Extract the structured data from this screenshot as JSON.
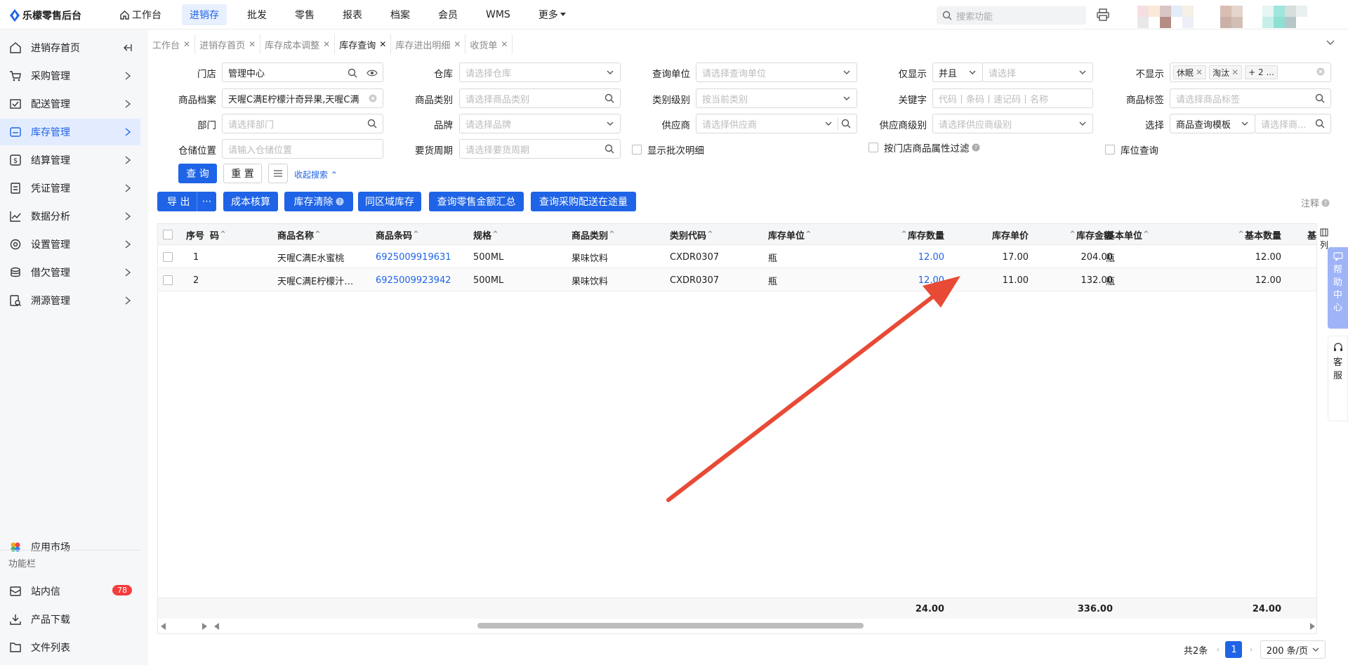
{
  "app": {
    "title": "乐檬零售后台"
  },
  "topnav": [
    {
      "label": "工作台",
      "icon": "home-icon"
    },
    {
      "label": "进销存",
      "active": true
    },
    {
      "label": "批发"
    },
    {
      "label": "零售"
    },
    {
      "label": "报表"
    },
    {
      "label": "档案"
    },
    {
      "label": "会员"
    },
    {
      "label": "WMS"
    },
    {
      "label": "更多"
    }
  ],
  "search": {
    "placeholder": "搜索功能"
  },
  "sidebar": {
    "items": [
      {
        "label": "进销存首页",
        "icon": "home-icon"
      },
      {
        "label": "采购管理",
        "icon": "cart-icon"
      },
      {
        "label": "配送管理",
        "icon": "delivery-icon"
      },
      {
        "label": "库存管理",
        "icon": "inventory-icon",
        "active": true
      },
      {
        "label": "结算管理",
        "icon": "settlement-icon"
      },
      {
        "label": "凭证管理",
        "icon": "voucher-icon"
      },
      {
        "label": "数据分析",
        "icon": "chart-icon"
      },
      {
        "label": "设置管理",
        "icon": "settings-icon"
      },
      {
        "label": "借欠管理",
        "icon": "debt-icon"
      },
      {
        "label": "溯源管理",
        "icon": "trace-icon"
      }
    ],
    "app_market": "应用市场",
    "section_label": "功能栏",
    "bottom": [
      {
        "label": "站内信",
        "badge": "78"
      },
      {
        "label": "产品下载"
      },
      {
        "label": "文件列表"
      }
    ]
  },
  "tabs": [
    {
      "label": "工作台"
    },
    {
      "label": "进销存首页"
    },
    {
      "label": "库存成本调整"
    },
    {
      "label": "库存查询",
      "active": true
    },
    {
      "label": "库存进出明细"
    },
    {
      "label": "收货单"
    }
  ],
  "filters": {
    "store": {
      "label": "门店",
      "value": "管理中心"
    },
    "warehouse": {
      "label": "仓库",
      "placeholder": "请选择仓库"
    },
    "query_unit": {
      "label": "查询单位",
      "placeholder": "请选择查询单位"
    },
    "only_show": {
      "label": "仅显示",
      "op": "并且",
      "placeholder": "请选择"
    },
    "hide": {
      "label": "不显示",
      "tags": [
        "休眠",
        "淘汰",
        "+ 2 ..."
      ]
    },
    "product": {
      "label": "商品档案",
      "value": "天喔C满E柠檬汁奇异果,天喔C满"
    },
    "category": {
      "label": "商品类别",
      "placeholder": "请选择商品类别"
    },
    "category_level": {
      "label": "类别级别",
      "placeholder": "按当前类别"
    },
    "keyword": {
      "label": "关键字",
      "placeholder": "代码丨条码丨速记码丨名称"
    },
    "tag": {
      "label": "商品标签",
      "placeholder": "请选择商品标签"
    },
    "dept": {
      "label": "部门",
      "placeholder": "请选择部门"
    },
    "brand": {
      "label": "品牌",
      "placeholder": "请选择品牌"
    },
    "supplier": {
      "label": "供应商",
      "placeholder": "请选择供应商"
    },
    "supplier_level": {
      "label": "供应商级别",
      "placeholder": "请选择供应商级别"
    },
    "select": {
      "label": "选择",
      "value": "商品查询模板",
      "placeholder": "请选择商..."
    },
    "location": {
      "label": "仓储位置",
      "placeholder": "请输入仓储位置"
    },
    "period": {
      "label": "要货周期",
      "placeholder": "请选择要货周期"
    },
    "show_batch": "显示批次明细",
    "store_attr": "按门店商品属性过滤",
    "location_query": "库位查询"
  },
  "actions": {
    "query": "查 询",
    "reset": "重 置",
    "collapse": "收起搜索",
    "export": "导 出",
    "cost_calc": "成本核算",
    "stock_clear": "库存清除",
    "same_area": "同区域库存",
    "retail_summary": "查询零售金额汇总",
    "transit": "查询采购配送在途量",
    "note": "注释",
    "columns": "列"
  },
  "table": {
    "headers": {
      "seq": "序号",
      "code_tail": "码",
      "name": "商品名称",
      "barcode": "商品条码",
      "spec": "规格",
      "category": "商品类别",
      "category_code": "类别代码",
      "unit": "库存单位",
      "qty": "库存数量",
      "price": "库存单价",
      "amount": "库存金额",
      "base_unit": "基本单位",
      "base_qty": "基本数量",
      "more": "基"
    },
    "rows": [
      {
        "seq": "1",
        "name": "天喔C满E水蜜桃",
        "barcode": "6925009919631",
        "spec": "500ML",
        "category": "果味饮料",
        "category_code": "CXDR0307",
        "unit": "瓶",
        "qty": "12.00",
        "price": "17.00",
        "amount": "204.00",
        "base_unit": "瓶",
        "base_qty": "12.00"
      },
      {
        "seq": "2",
        "name": "天喔C满E柠檬汁…",
        "barcode": "6925009923942",
        "spec": "500ML",
        "category": "果味饮料",
        "category_code": "CXDR0307",
        "unit": "瓶",
        "qty": "12.00",
        "price": "11.00",
        "amount": "132.00",
        "base_unit": "瓶",
        "base_qty": "12.00"
      }
    ],
    "totals": {
      "qty": "24.00",
      "amount": "336.00",
      "base_qty": "24.00"
    }
  },
  "pager": {
    "total": "共2条",
    "page": "1",
    "size": "200 条/页"
  },
  "float": {
    "help": [
      "帮",
      "助",
      "中",
      "心"
    ],
    "service": [
      "客",
      "服"
    ]
  }
}
